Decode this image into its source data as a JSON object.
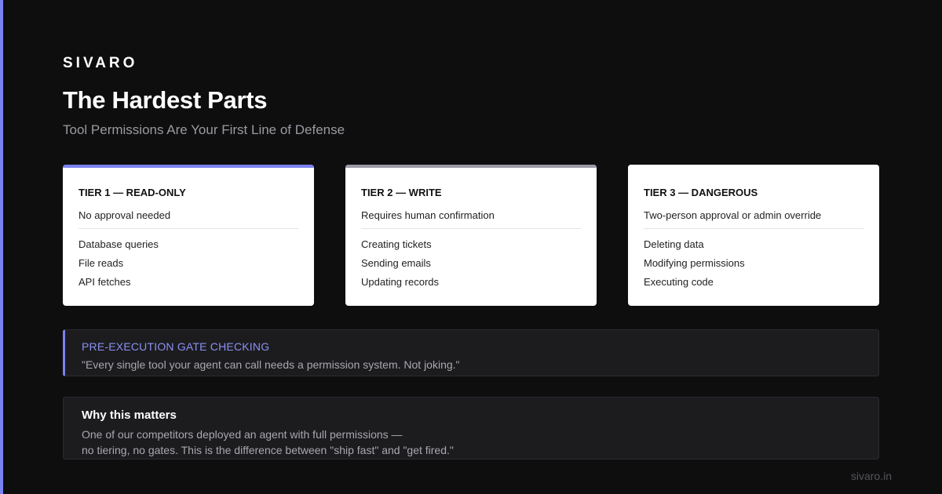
{
  "brand": "SIVARO",
  "title": "The Hardest Parts",
  "subtitle": "Tool Permissions Are Your First Line of Defense",
  "colors": {
    "accent": "#7b82f0",
    "background": "#0e0e0f",
    "card": "#ffffff",
    "tier1_bar": "#7b82f0",
    "tier2_bar": "#9a9ba6",
    "tier3_bar": "#ffffff"
  },
  "tiers": [
    {
      "name": "TIER 1 — READ-ONLY",
      "approval": "No approval needed",
      "items": [
        "Database queries",
        "File reads",
        "API fetches"
      ]
    },
    {
      "name": "TIER 2 — WRITE",
      "approval": "Requires human confirmation",
      "items": [
        "Creating tickets",
        "Sending emails",
        "Updating records"
      ]
    },
    {
      "name": "TIER 3 — DANGEROUS",
      "approval": "Two-person approval or admin override",
      "items": [
        "Deleting data",
        "Modifying permissions",
        "Executing code"
      ]
    }
  ],
  "gate": {
    "heading": "PRE-EXECUTION GATE CHECKING",
    "quote": "\"Every single tool your agent can call needs a permission system. Not joking.\""
  },
  "why": {
    "heading": "Why this matters",
    "line1": "One of our competitors deployed an agent with full permissions —",
    "line2": "no tiering, no gates. This is the difference between \"ship fast\" and \"get fired.\""
  },
  "footer": {
    "url": "sivaro.in"
  }
}
